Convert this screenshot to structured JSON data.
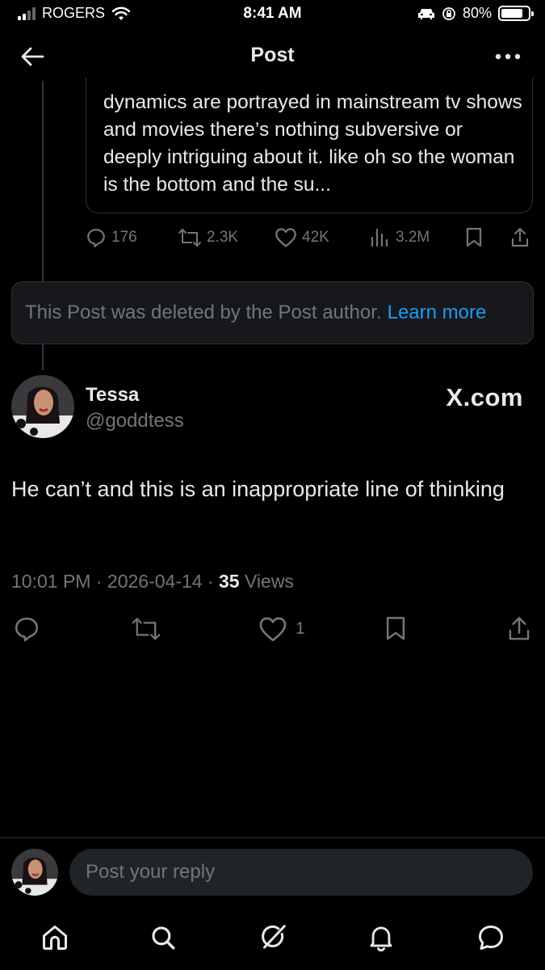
{
  "status_bar": {
    "carrier": "ROGERS",
    "time": "8:41 AM",
    "battery": "80%",
    "battery_level": 0.8
  },
  "header": {
    "title": "Post"
  },
  "quoted_post": {
    "text": "dynamics are portrayed in mainstream tv shows and movies there’s nothing subversive or deeply intriguing about it. like oh so the woman is the bottom and the su...",
    "replies": "176",
    "reposts": "2.3K",
    "likes": "42K",
    "views": "3.2M"
  },
  "deleted_notice": {
    "text": "This Post was deleted by the Post author.",
    "link": "Learn more"
  },
  "post": {
    "author_name": "Tessa",
    "author_handle": "@goddtess",
    "watermark": "X.com",
    "text": "He can’t and this is an inappropriate line of thinking",
    "time": "10:01 PM",
    "separator": "·",
    "date": "2026-04-14",
    "views_count": "35",
    "views_label": "Views",
    "likes": "1"
  },
  "reply_bar": {
    "placeholder": "Post your reply"
  },
  "icons": {
    "back": "arrow-left-icon",
    "more": "more-dots-icon",
    "reply": "comment-icon",
    "repost": "repost-icon",
    "like": "heart-icon",
    "views": "views-icon",
    "bookmark": "bookmark-icon",
    "share": "share-icon",
    "home": "home-icon",
    "search": "search-icon",
    "grok": "grok-icon",
    "notifications": "bell-icon",
    "messages": "message-icon"
  },
  "colors": {
    "background": "#000000",
    "text": "#e7e9ea",
    "muted": "#71767b",
    "link": "#1d9bf0",
    "card": "#16181c",
    "border": "#2f3336"
  }
}
